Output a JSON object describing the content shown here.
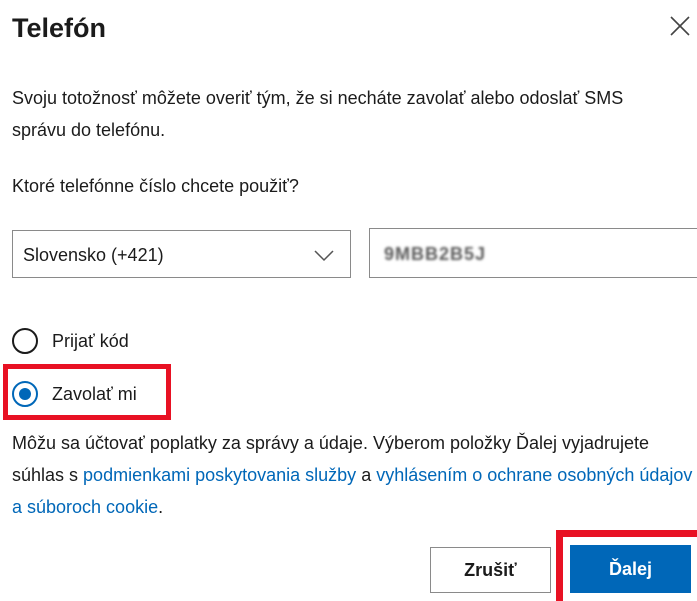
{
  "dialog": {
    "title": "Telefón",
    "close_icon": "close-icon",
    "description": "Svoju totožnosť môžete overiť tým, že si necháte zavolať alebo odoslať SMS správu do telefónu.",
    "question": "Ktoré telefónne číslo chcete použiť?"
  },
  "form": {
    "country_value": "Slovensko (+421)",
    "phone_value": "9MBB2B5J",
    "options": [
      {
        "label": "Prijať kód",
        "selected": false
      },
      {
        "label": "Zavolať mi",
        "selected": true
      }
    ]
  },
  "terms": {
    "text_before": "Môžu sa účtovať poplatky za správy a údaje. Výberom položky Ďalej vyjadrujete súhlas s ",
    "link_terms": "podmienkami poskytovania služby",
    "text_middle": " a ",
    "link_privacy": "vyhlásením o ochrane osobných údajov a súboroch cookie",
    "text_after": "."
  },
  "buttons": {
    "cancel": "Zrušiť",
    "next": "Ďalej"
  },
  "colors": {
    "accent": "#0067b8",
    "highlight": "#e81123",
    "text": "#1b1b1b",
    "border": "#8a8a8a"
  }
}
